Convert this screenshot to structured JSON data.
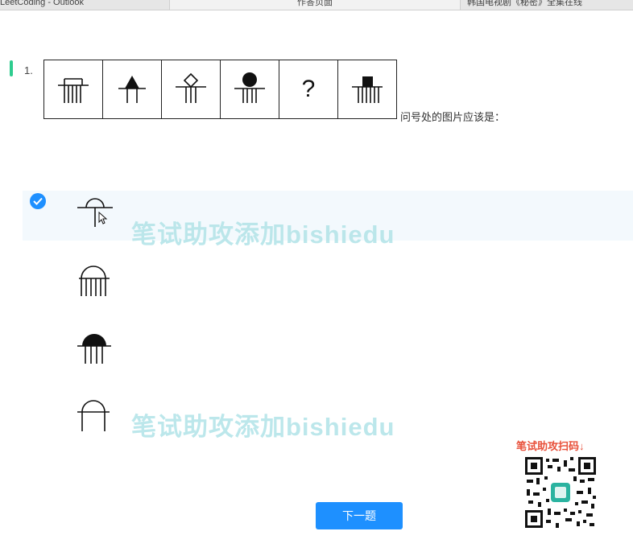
{
  "browser": {
    "tab_left": "LeetCoding - Outlook",
    "tab_center": "作答页面",
    "tab_right": "韩国电视剧《秘密》全集在线"
  },
  "question": {
    "number": "1.",
    "text": "问号处的图片应该是：",
    "sequence": [
      "comb",
      "triangle",
      "diamond",
      "circle",
      "?",
      "square"
    ]
  },
  "options": [
    {
      "figure": "half-circle-open-stem",
      "selected": true
    },
    {
      "figure": "arch-comb",
      "selected": false
    },
    {
      "figure": "filled-dome-comb",
      "selected": false
    },
    {
      "figure": "arch-two-legs",
      "selected": false
    }
  ],
  "watermark": "笔试助攻添加bishiedu",
  "next_button": "下一题",
  "promo": "笔试助攻扫码↓",
  "colors": {
    "accent": "#1e90ff",
    "marker": "#2ecc8f",
    "watermark": "#b9e6ea",
    "promo": "#e8503a"
  }
}
